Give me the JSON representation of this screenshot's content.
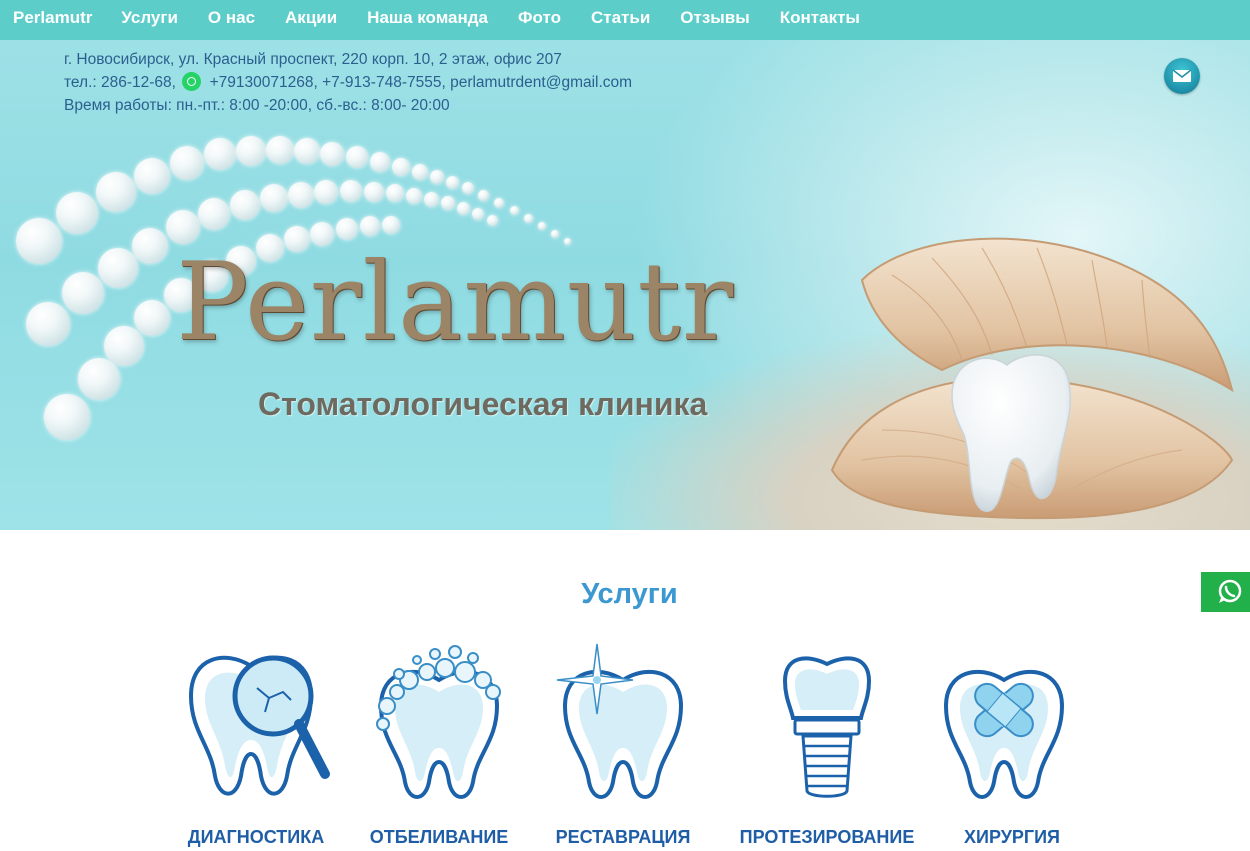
{
  "nav": {
    "brand": "Perlamutr",
    "items": [
      "Услуги",
      "О нас",
      "Акции",
      "Наша команда",
      "Фото",
      "Статьи",
      "Отзывы",
      "Контакты"
    ]
  },
  "contact": {
    "address": "г. Новосибирск, ул. Красный проспект, 220 корп. 10, 2 этаж, офис 207",
    "phone_prefix": "тел.: 286-12-68,",
    "whatsapp_phone": "+79130071268",
    "phone_rest": ", +7-913-748-7555, ",
    "email": "perlamutrdent@gmail.com",
    "hours": "Время работы: пн.-пт.: 8:00 -20:00, сб.-вс.: 8:00- 20:00"
  },
  "hero": {
    "logo": "Perlamutr",
    "subtitle": "Стоматологическая клиника"
  },
  "services": {
    "title": "Услуги",
    "items": [
      {
        "label": "ДИАГНОСТИКА",
        "icon": "tooth-magnifier-icon"
      },
      {
        "label": "ОТБЕЛИВАНИЕ",
        "icon": "tooth-bubbles-icon"
      },
      {
        "label": "РЕСТАВРАЦИЯ",
        "icon": "tooth-sparkle-icon"
      },
      {
        "label": "ПРОТЕЗИРОВАНИЕ",
        "icon": "tooth-implant-icon"
      },
      {
        "label": "ХИРУРГИЯ",
        "icon": "tooth-bandage-icon"
      }
    ]
  },
  "icons": {
    "mail": "mail-icon",
    "whatsapp": "whatsapp-icon"
  },
  "colors": {
    "nav_bg": "#5ccdc9",
    "title": "#3b98d0",
    "service_label": "#1f5ea6",
    "whatsapp": "#22b04b"
  }
}
